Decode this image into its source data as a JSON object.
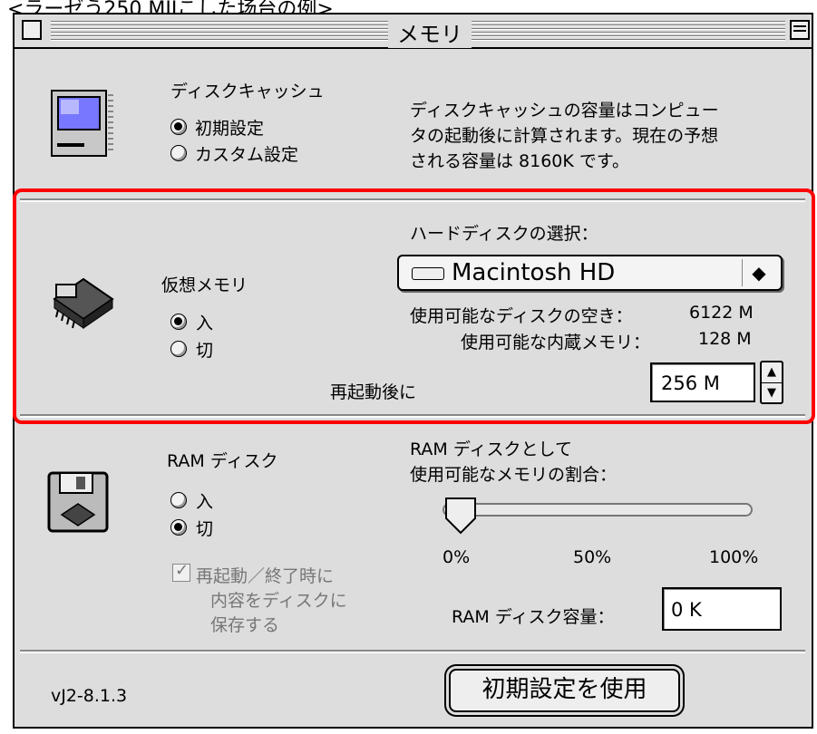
{
  "caption": "<ラーゼう250 MIIこした场台の例>",
  "window": {
    "title": "メモリ"
  },
  "disk_cache": {
    "title": "ディスクキャッシュ",
    "options": [
      {
        "label": "初期設定",
        "selected": true
      },
      {
        "label": "カスタム設定",
        "selected": false
      }
    ],
    "info_lines": [
      "ディスクキャッシュの容量はコンピュー",
      "タの起動後に計算されます。現在の予想",
      "される容量は 8160K です。"
    ]
  },
  "virtual_memory": {
    "title": "仮想メモリ",
    "options": [
      {
        "label": "入",
        "selected": true
      },
      {
        "label": "切",
        "selected": false
      }
    ],
    "disk_select_label": "ハードディスクの選択：",
    "disk_selected": "Macintosh HD",
    "disk_free_label": "使用可能なディスクの空き：",
    "disk_free_value": "6122 M",
    "builtin_mem_label": "使用可能な内蔵メモリ：",
    "builtin_mem_value": "128 M",
    "after_restart_label": "再起動後に",
    "after_restart_value": "256 M"
  },
  "ram_disk": {
    "title": "RAM ディスク",
    "options": [
      {
        "label": "入",
        "selected": false
      },
      {
        "label": "切",
        "selected": true
      }
    ],
    "ratio_label_1": "RAM ディスクとして",
    "ratio_label_2": "使用可能なメモリの割合：",
    "slider_value": 0,
    "slider_ticks": [
      "0%",
      "50%",
      "100%"
    ],
    "save_checkbox_lines": [
      "再起動／終了時に",
      "内容をディスクに",
      "保存する"
    ],
    "save_checkbox_checked": true,
    "size_label": "RAM ディスク容量：",
    "size_value": "0 K"
  },
  "footer": {
    "version": "vJ2-8.1.3",
    "default_button": "初期設定を使用"
  },
  "highlight_color": "#ff0000"
}
